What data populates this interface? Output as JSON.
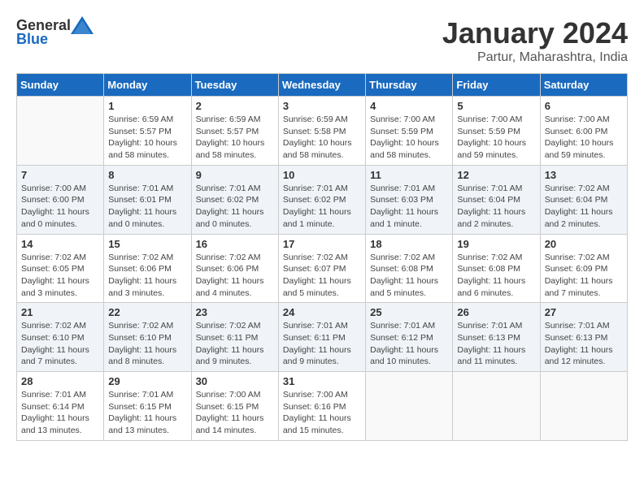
{
  "header": {
    "logo_general": "General",
    "logo_blue": "Blue",
    "month_year": "January 2024",
    "location": "Partur, Maharashtra, India"
  },
  "weekdays": [
    "Sunday",
    "Monday",
    "Tuesday",
    "Wednesday",
    "Thursday",
    "Friday",
    "Saturday"
  ],
  "weeks": [
    [
      {
        "day": "",
        "info": ""
      },
      {
        "day": "1",
        "info": "Sunrise: 6:59 AM\nSunset: 5:57 PM\nDaylight: 10 hours\nand 58 minutes."
      },
      {
        "day": "2",
        "info": "Sunrise: 6:59 AM\nSunset: 5:57 PM\nDaylight: 10 hours\nand 58 minutes."
      },
      {
        "day": "3",
        "info": "Sunrise: 6:59 AM\nSunset: 5:58 PM\nDaylight: 10 hours\nand 58 minutes."
      },
      {
        "day": "4",
        "info": "Sunrise: 7:00 AM\nSunset: 5:59 PM\nDaylight: 10 hours\nand 58 minutes."
      },
      {
        "day": "5",
        "info": "Sunrise: 7:00 AM\nSunset: 5:59 PM\nDaylight: 10 hours\nand 59 minutes."
      },
      {
        "day": "6",
        "info": "Sunrise: 7:00 AM\nSunset: 6:00 PM\nDaylight: 10 hours\nand 59 minutes."
      }
    ],
    [
      {
        "day": "7",
        "info": "Sunrise: 7:00 AM\nSunset: 6:00 PM\nDaylight: 11 hours\nand 0 minutes."
      },
      {
        "day": "8",
        "info": "Sunrise: 7:01 AM\nSunset: 6:01 PM\nDaylight: 11 hours\nand 0 minutes."
      },
      {
        "day": "9",
        "info": "Sunrise: 7:01 AM\nSunset: 6:02 PM\nDaylight: 11 hours\nand 0 minutes."
      },
      {
        "day": "10",
        "info": "Sunrise: 7:01 AM\nSunset: 6:02 PM\nDaylight: 11 hours\nand 1 minute."
      },
      {
        "day": "11",
        "info": "Sunrise: 7:01 AM\nSunset: 6:03 PM\nDaylight: 11 hours\nand 1 minute."
      },
      {
        "day": "12",
        "info": "Sunrise: 7:01 AM\nSunset: 6:04 PM\nDaylight: 11 hours\nand 2 minutes."
      },
      {
        "day": "13",
        "info": "Sunrise: 7:02 AM\nSunset: 6:04 PM\nDaylight: 11 hours\nand 2 minutes."
      }
    ],
    [
      {
        "day": "14",
        "info": "Sunrise: 7:02 AM\nSunset: 6:05 PM\nDaylight: 11 hours\nand 3 minutes."
      },
      {
        "day": "15",
        "info": "Sunrise: 7:02 AM\nSunset: 6:06 PM\nDaylight: 11 hours\nand 3 minutes."
      },
      {
        "day": "16",
        "info": "Sunrise: 7:02 AM\nSunset: 6:06 PM\nDaylight: 11 hours\nand 4 minutes."
      },
      {
        "day": "17",
        "info": "Sunrise: 7:02 AM\nSunset: 6:07 PM\nDaylight: 11 hours\nand 5 minutes."
      },
      {
        "day": "18",
        "info": "Sunrise: 7:02 AM\nSunset: 6:08 PM\nDaylight: 11 hours\nand 5 minutes."
      },
      {
        "day": "19",
        "info": "Sunrise: 7:02 AM\nSunset: 6:08 PM\nDaylight: 11 hours\nand 6 minutes."
      },
      {
        "day": "20",
        "info": "Sunrise: 7:02 AM\nSunset: 6:09 PM\nDaylight: 11 hours\nand 7 minutes."
      }
    ],
    [
      {
        "day": "21",
        "info": "Sunrise: 7:02 AM\nSunset: 6:10 PM\nDaylight: 11 hours\nand 7 minutes."
      },
      {
        "day": "22",
        "info": "Sunrise: 7:02 AM\nSunset: 6:10 PM\nDaylight: 11 hours\nand 8 minutes."
      },
      {
        "day": "23",
        "info": "Sunrise: 7:02 AM\nSunset: 6:11 PM\nDaylight: 11 hours\nand 9 minutes."
      },
      {
        "day": "24",
        "info": "Sunrise: 7:01 AM\nSunset: 6:11 PM\nDaylight: 11 hours\nand 9 minutes."
      },
      {
        "day": "25",
        "info": "Sunrise: 7:01 AM\nSunset: 6:12 PM\nDaylight: 11 hours\nand 10 minutes."
      },
      {
        "day": "26",
        "info": "Sunrise: 7:01 AM\nSunset: 6:13 PM\nDaylight: 11 hours\nand 11 minutes."
      },
      {
        "day": "27",
        "info": "Sunrise: 7:01 AM\nSunset: 6:13 PM\nDaylight: 11 hours\nand 12 minutes."
      }
    ],
    [
      {
        "day": "28",
        "info": "Sunrise: 7:01 AM\nSunset: 6:14 PM\nDaylight: 11 hours\nand 13 minutes."
      },
      {
        "day": "29",
        "info": "Sunrise: 7:01 AM\nSunset: 6:15 PM\nDaylight: 11 hours\nand 13 minutes."
      },
      {
        "day": "30",
        "info": "Sunrise: 7:00 AM\nSunset: 6:15 PM\nDaylight: 11 hours\nand 14 minutes."
      },
      {
        "day": "31",
        "info": "Sunrise: 7:00 AM\nSunset: 6:16 PM\nDaylight: 11 hours\nand 15 minutes."
      },
      {
        "day": "",
        "info": ""
      },
      {
        "day": "",
        "info": ""
      },
      {
        "day": "",
        "info": ""
      }
    ]
  ]
}
